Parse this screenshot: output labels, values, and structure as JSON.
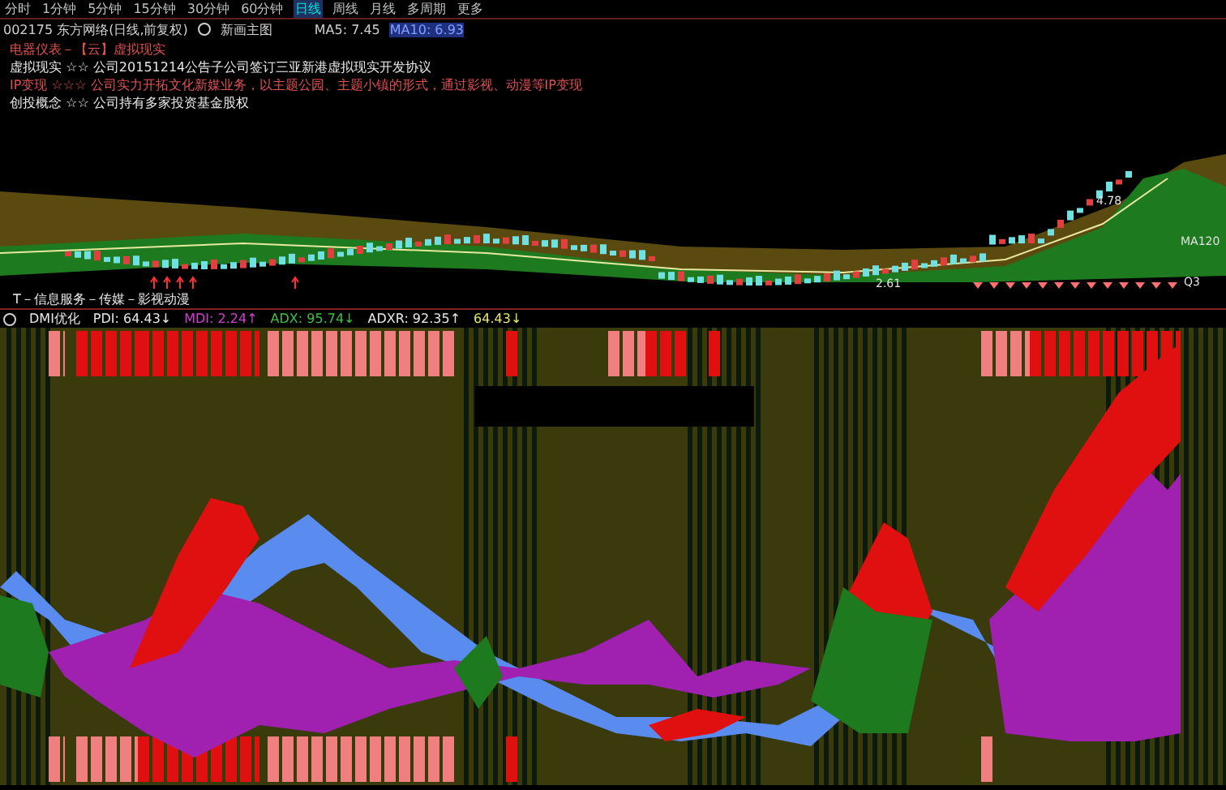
{
  "period_tabs": [
    {
      "label": "分时",
      "selected": false
    },
    {
      "label": "1分钟",
      "selected": false
    },
    {
      "label": "5分钟",
      "selected": false
    },
    {
      "label": "15分钟",
      "selected": false
    },
    {
      "label": "30分钟",
      "selected": false
    },
    {
      "label": "60分钟",
      "selected": false
    },
    {
      "label": "日线",
      "selected": true
    },
    {
      "label": "周线",
      "selected": false
    },
    {
      "label": "月线",
      "selected": false
    },
    {
      "label": "多周期",
      "selected": false
    },
    {
      "label": "更多",
      "selected": false
    }
  ],
  "stock_header": {
    "title": "002175 东方网络(日线,前复权)",
    "main_chart": "新画主图",
    "ma5": "MA5: 7.45",
    "ma10": "MA10: 6.93"
  },
  "concepts": [
    {
      "text": "电器仪表－【云】虚拟现实",
      "color": "#e05050"
    },
    {
      "text": "虚拟现实 ☆☆ 公司20151214公告子公司签订三亚新港虚拟现实开发协议",
      "color": "#e8e8e8"
    },
    {
      "text": "IP变现 ☆☆☆ 公司实力开拓文化新媒业务，以主题公园、主题小镇的形式，通过影视、动漫等IP变现",
      "color": "#e05050"
    },
    {
      "text": "创投概念 ☆☆ 公司持有多家投资基金股权",
      "color": "#e8e8e8"
    }
  ],
  "price_labels": {
    "high": "4.78",
    "ma": "MA120",
    "low": "2.61",
    "quarter": "Q3"
  },
  "industry": "T－信息服务－传媒－影视动漫",
  "indicator": {
    "name": "DMI优化",
    "values": [
      {
        "label": "PDI: 64.43↓",
        "color": "#e8e8e8"
      },
      {
        "label": "MDI: 2.24↑",
        "color": "#d040d0"
      },
      {
        "label": "ADX: 95.74↓",
        "color": "#40c040"
      },
      {
        "label": "ADXR: 92.35↑",
        "color": "#e8e8e8"
      },
      {
        "label": "64.43↓",
        "color": "#e8e860"
      }
    ]
  }
}
